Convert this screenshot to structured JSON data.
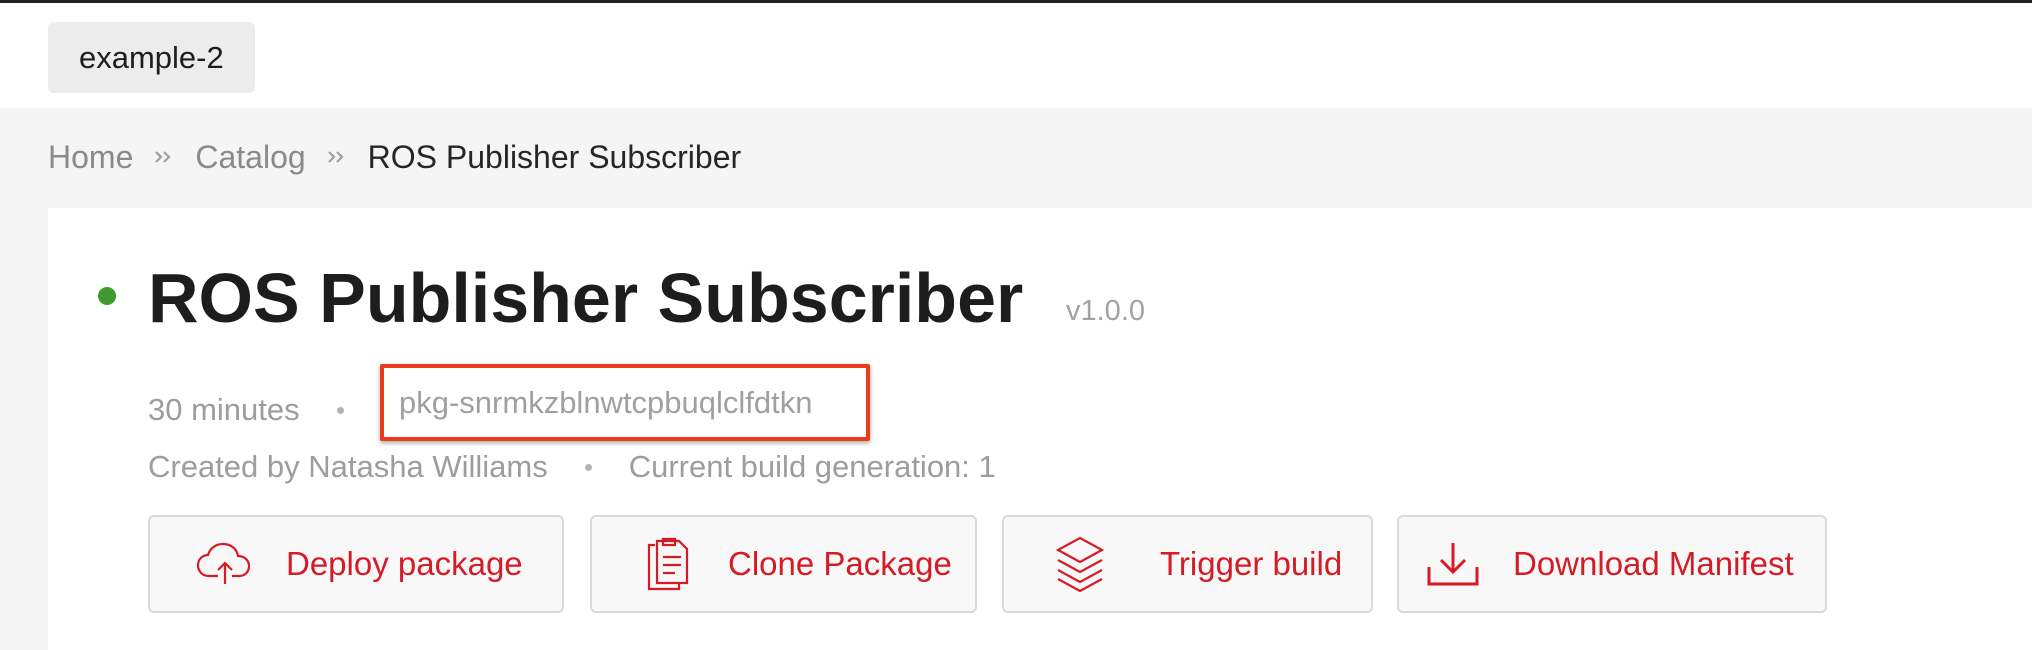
{
  "topbar": {
    "tag": "example-2"
  },
  "breadcrumb": {
    "home": "Home",
    "catalog": "Catalog",
    "current": "ROS Publisher Subscriber"
  },
  "package": {
    "title": "ROS Publisher Subscriber",
    "version": "v1.0.0",
    "status_color": "#3e9a2c",
    "age": "30 minutes",
    "id": "pkg-snrmkzblnwtcpbuqlclfdtkn",
    "created_by": "Created by Natasha Williams",
    "build_generation": "Current build generation: 1"
  },
  "actions": [
    {
      "label": "Deploy package",
      "icon": "cloud-upload-icon"
    },
    {
      "label": "Clone Package",
      "icon": "clone-document-icon"
    },
    {
      "label": "Trigger build",
      "icon": "layers-icon"
    },
    {
      "label": "Download Manifest",
      "icon": "download-icon"
    }
  ],
  "colors": {
    "accent": "#d51b25",
    "highlight_border": "#ec3b1a"
  }
}
